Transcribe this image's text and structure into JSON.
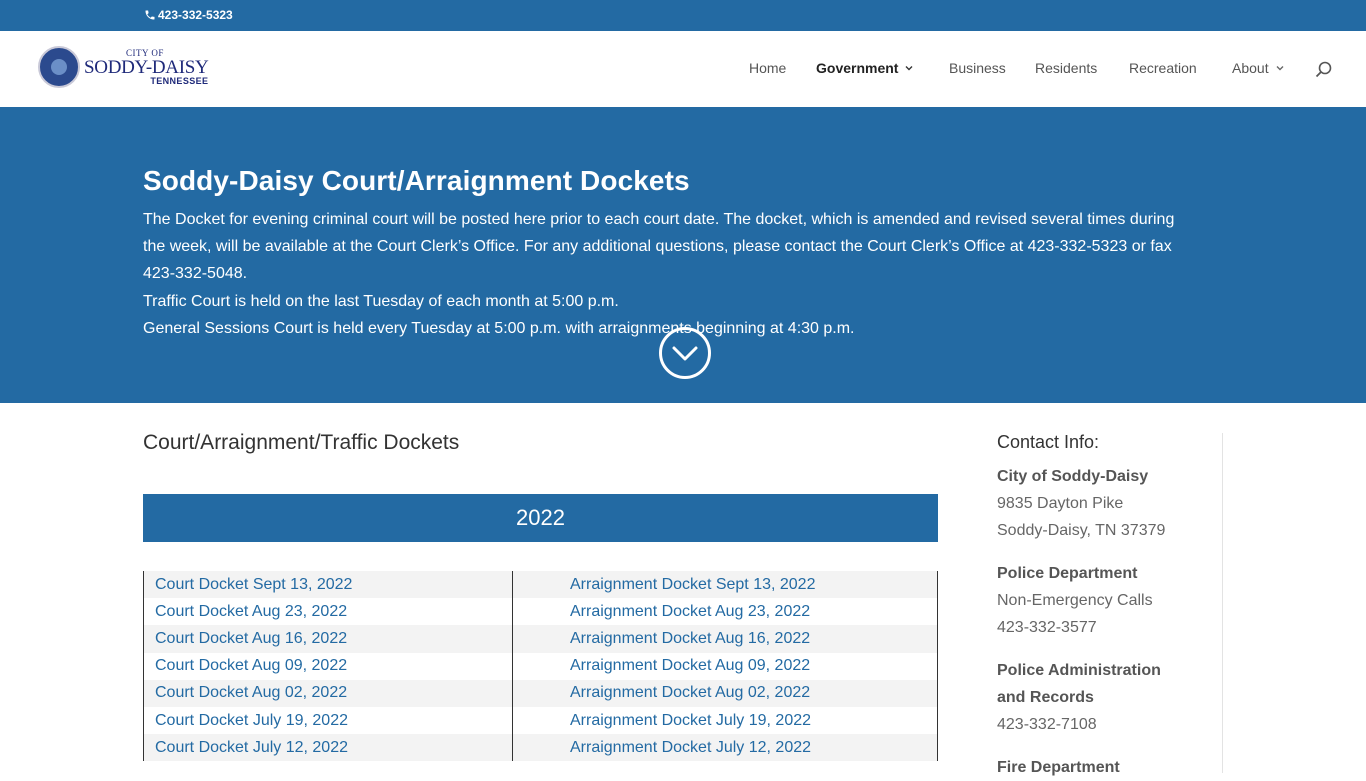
{
  "topbar": {
    "phone": "423-332-5323"
  },
  "logo": {
    "line1": "CITY OF",
    "line2": "SODDY-DAISY",
    "line3": "TENNESSEE"
  },
  "nav": [
    {
      "label": "Home",
      "dropdown": false,
      "active": false
    },
    {
      "label": "Government",
      "dropdown": true,
      "active": true
    },
    {
      "label": "Business",
      "dropdown": false,
      "active": false
    },
    {
      "label": "Residents",
      "dropdown": false,
      "active": false
    },
    {
      "label": "Recreation",
      "dropdown": false,
      "active": false
    },
    {
      "label": "About",
      "dropdown": true,
      "active": false
    }
  ],
  "hero": {
    "title": "Soddy-Daisy Court/Arraignment Dockets",
    "paragraph1": "The Docket for evening criminal court will be posted here prior to each court date. The docket, which is amended and revised several times during the week, will be available at the Court Clerk’s Office. For any additional questions, please contact the Court Clerk’s Office at 423-332-5323 or fax 423-332-5048.",
    "paragraph2": "Traffic Court is held on the last Tuesday of each month at 5:00 p.m.",
    "paragraph3": "General Sessions Court is held every Tuesday at 5:00 p.m. with arraignments beginning at 4:30 p.m."
  },
  "main": {
    "section_title": "Court/Arraignment/Traffic Dockets",
    "year": "2022",
    "dockets": [
      {
        "court": "Court Docket Sept 13, 2022",
        "arraignment": "Arraignment Docket Sept 13, 2022"
      },
      {
        "court": "Court Docket Aug 23, 2022",
        "arraignment": "Arraignment Docket Aug 23, 2022"
      },
      {
        "court": "Court Docket Aug 16, 2022",
        "arraignment": "Arraignment Docket Aug 16, 2022"
      },
      {
        "court": "Court Docket Aug 09, 2022",
        "arraignment": "Arraignment Docket Aug 09, 2022"
      },
      {
        "court": "Court Docket Aug 02, 2022",
        "arraignment": "Arraignment Docket Aug 02, 2022"
      },
      {
        "court": "Court Docket July 19, 2022",
        "arraignment": "Arraignment Docket July 19, 2022"
      },
      {
        "court": "Court Docket July 12, 2022",
        "arraignment": "Arraignment Docket July 12, 2022"
      }
    ]
  },
  "sidebar": {
    "title": "Contact Info:",
    "city_name": "City of Soddy-Daisy",
    "city_address1": "9835 Dayton Pike",
    "city_address2": "Soddy-Daisy, TN 37379",
    "police_title": "Police Department",
    "police_label": "Non-Emergency Calls",
    "police_phone": "423-332-3577",
    "admin_title1": "Police Administration",
    "admin_title2": "and Records",
    "admin_phone": "423-332-7108",
    "fire_title": "Fire Department"
  },
  "colors": {
    "brand_blue": "#236aa3",
    "link": "#236aa3"
  },
  "icons": [
    "phone-icon",
    "chevron-down-icon",
    "search-icon",
    "circle-chevron-down-icon"
  ]
}
